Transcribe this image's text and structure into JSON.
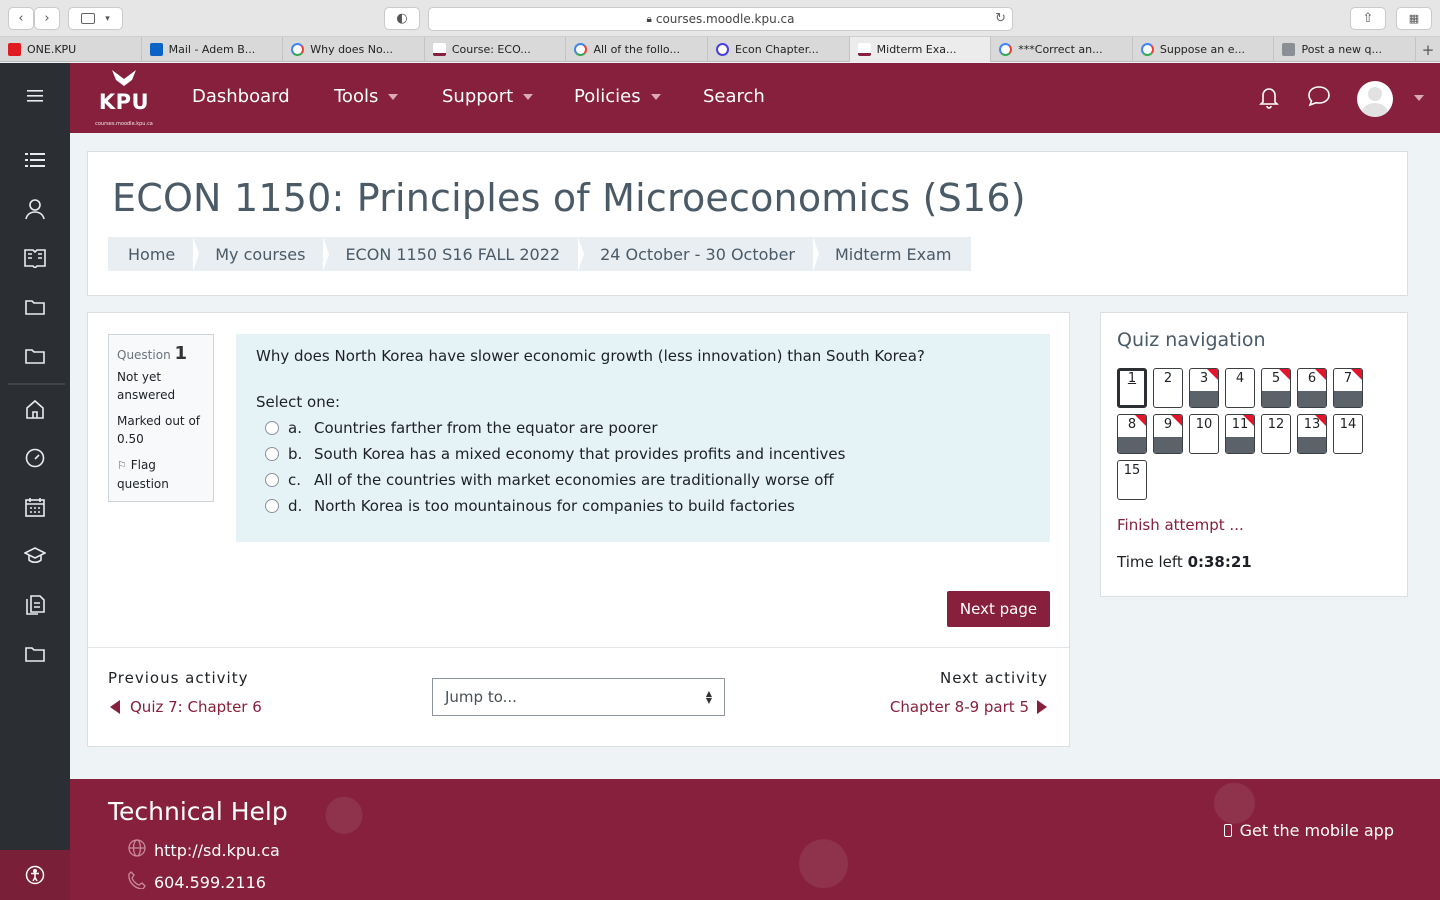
{
  "browser": {
    "url": "courses.moodle.kpu.ca",
    "tabs": [
      {
        "label": "ONE.KPU",
        "icon": "red"
      },
      {
        "label": "Mail - Adem B...",
        "icon": "outlook"
      },
      {
        "label": "Why does No...",
        "icon": "google"
      },
      {
        "label": "Course: ECO...",
        "icon": "kpu"
      },
      {
        "label": "All of the follo...",
        "icon": "google"
      },
      {
        "label": "Econ Chapter...",
        "icon": "quizlet"
      },
      {
        "label": "Midterm Exa...",
        "icon": "kpu"
      },
      {
        "label": "***Correct an...",
        "icon": "google"
      },
      {
        "label": "Suppose an e...",
        "icon": "google"
      },
      {
        "label": "Post a new q...",
        "icon": "chegg"
      }
    ]
  },
  "navbar": {
    "logo": "KPU",
    "logo_sub": "courses.moodle.kpu.ca",
    "menu": [
      "Dashboard",
      "Tools",
      "Support",
      "Policies",
      "Search"
    ]
  },
  "header": {
    "course_title": "ECON 1150: Principles of Microeconomics (S16)",
    "breadcrumbs": [
      "Home",
      "My courses",
      "ECON 1150 S16 FALL 2022",
      "24 October - 30 October",
      "Midterm Exam"
    ]
  },
  "question": {
    "label": "Question",
    "number": "1",
    "status": "Not yet answered",
    "marked": "Marked out of 0.50",
    "flag": "Flag question",
    "text": "Why does North Korea have slower economic growth (less innovation) than South Korea?",
    "prompt": "Select one:",
    "answers": [
      {
        "letter": "a.",
        "text": "Countries farther from the equator are poorer"
      },
      {
        "letter": "b.",
        "text": "South Korea has a mixed economy that provides profits and incentives"
      },
      {
        "letter": "c.",
        "text": "All of the countries with market economies are traditionally worse off"
      },
      {
        "letter": "d.",
        "text": "North Korea is too mountainous for companies to build factories"
      }
    ],
    "next_button": "Next page"
  },
  "activity_nav": {
    "previous_label": "Previous activity",
    "previous_link": "Quiz 7:  Chapter 6",
    "jump_placeholder": "Jump to...",
    "next_label": "Next activity",
    "next_link": "Chapter 8-9 part 5"
  },
  "quiz_nav": {
    "title": "Quiz navigation",
    "buttons": [
      {
        "n": "1",
        "state": "current"
      },
      {
        "n": "2",
        "state": "unanswered"
      },
      {
        "n": "3",
        "state": "answered-flagged"
      },
      {
        "n": "4",
        "state": "unanswered"
      },
      {
        "n": "5",
        "state": "answered-flagged"
      },
      {
        "n": "6",
        "state": "answered-flagged"
      },
      {
        "n": "7",
        "state": "answered-flagged"
      },
      {
        "n": "8",
        "state": "answered-flagged"
      },
      {
        "n": "9",
        "state": "answered-flagged"
      },
      {
        "n": "10",
        "state": "unanswered"
      },
      {
        "n": "11",
        "state": "answered-flagged"
      },
      {
        "n": "12",
        "state": "unanswered"
      },
      {
        "n": "13",
        "state": "answered-flagged"
      },
      {
        "n": "14",
        "state": "unanswered"
      },
      {
        "n": "15",
        "state": "unanswered"
      }
    ],
    "finish": "Finish attempt ...",
    "time_label": "Time left",
    "time_value": "0:38:21"
  },
  "footer": {
    "title": "Technical Help",
    "link": "http://sd.kpu.ca",
    "phone": "604.599.2116",
    "mobile_app": "Get the mobile app"
  },
  "colors": {
    "brand": "#86203c",
    "sidebar": "#2b2f33",
    "flag": "#e2152b"
  }
}
